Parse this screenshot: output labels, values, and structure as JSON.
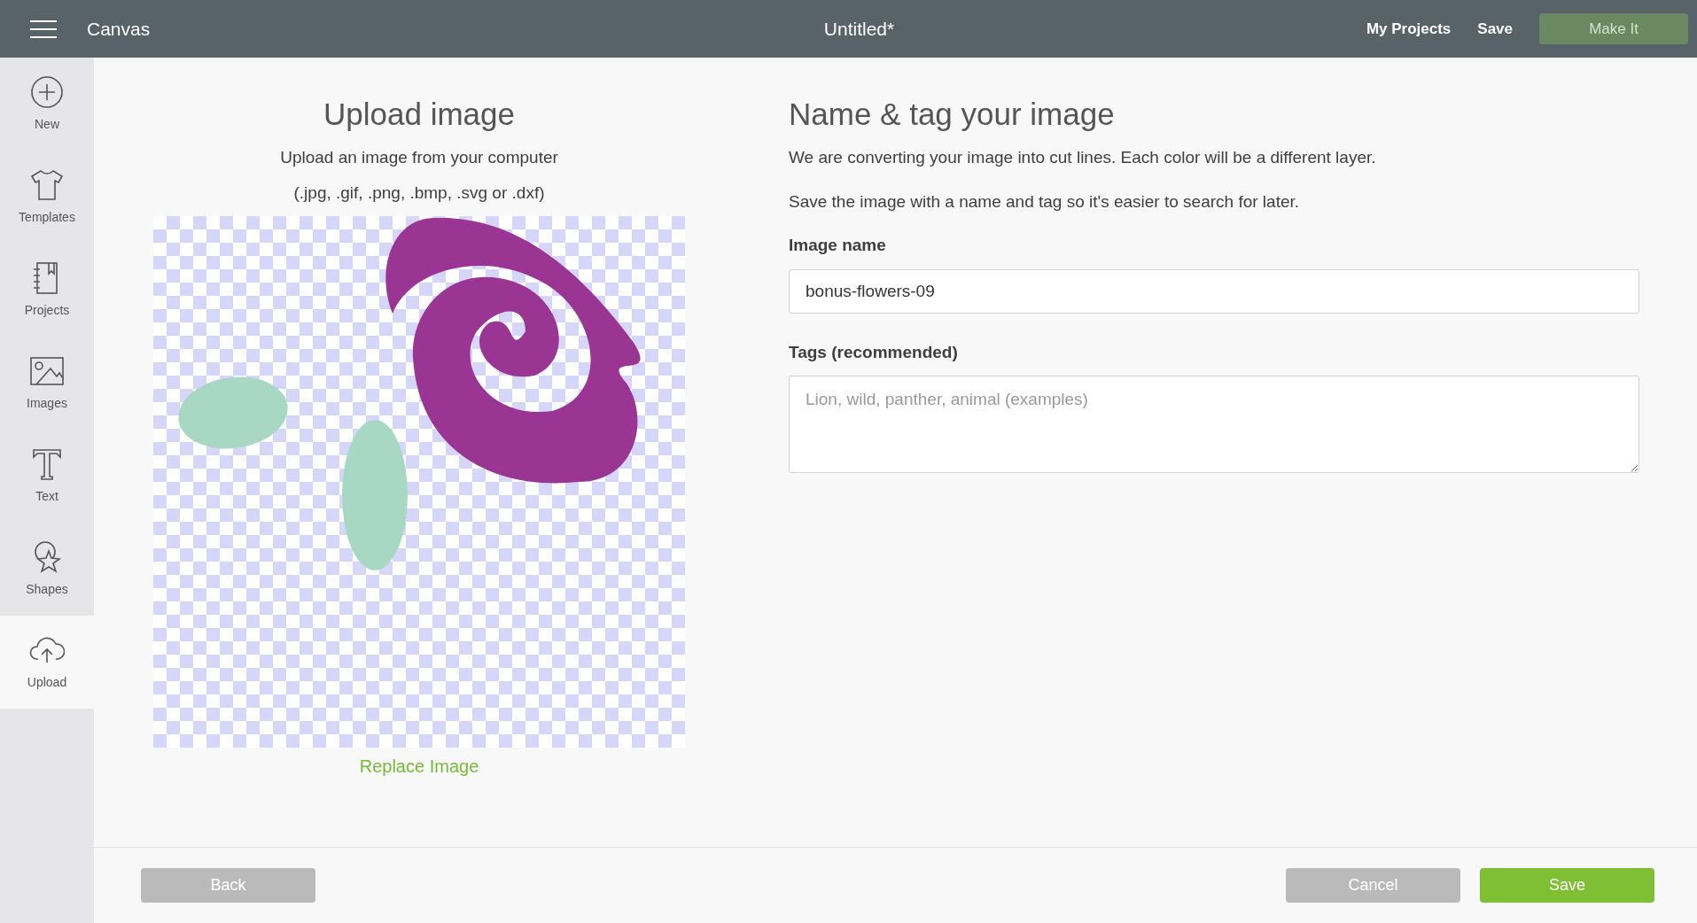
{
  "topbar": {
    "app_name": "Canvas",
    "title": "Untitled*",
    "actions": [
      {
        "label": "My Projects",
        "kind": "link"
      },
      {
        "label": "Save",
        "kind": "link"
      },
      {
        "label": "Make It",
        "kind": "button",
        "disabled": true
      }
    ]
  },
  "sidebar": {
    "items": [
      {
        "label": "New",
        "selected": false
      },
      {
        "label": "Templates",
        "selected": false
      },
      {
        "label": "Projects",
        "selected": false
      },
      {
        "label": "Images",
        "selected": false
      },
      {
        "label": "Text",
        "selected": false
      },
      {
        "label": "Shapes",
        "selected": false
      },
      {
        "label": "Upload",
        "selected": true
      }
    ]
  },
  "upload": {
    "title": "Upload image",
    "subtitle": "Upload an image from your computer",
    "formats": "(.jpg, .gif, .png, .bmp, .svg or .dxf)",
    "replace_link": "Replace Image"
  },
  "details": {
    "title": "Name & tag your image",
    "lines": [
      "We are converting your image into cut lines. Each color will be a different layer.",
      "Save the image with a name and tag so it's easier to search for later."
    ],
    "fields": [
      {
        "label": "Image name",
        "kind": "input",
        "value": "bonus-flowers-09"
      },
      {
        "label": "Tags (recommended)",
        "kind": "textarea",
        "placeholder": "Lion, wild, panther, animal (examples)"
      }
    ]
  },
  "footer": {
    "buttons": [
      {
        "label": "Back",
        "kind": "secondary"
      },
      {
        "label": "Cancel",
        "kind": "secondary"
      },
      {
        "label": "Save",
        "kind": "primary"
      }
    ]
  }
}
